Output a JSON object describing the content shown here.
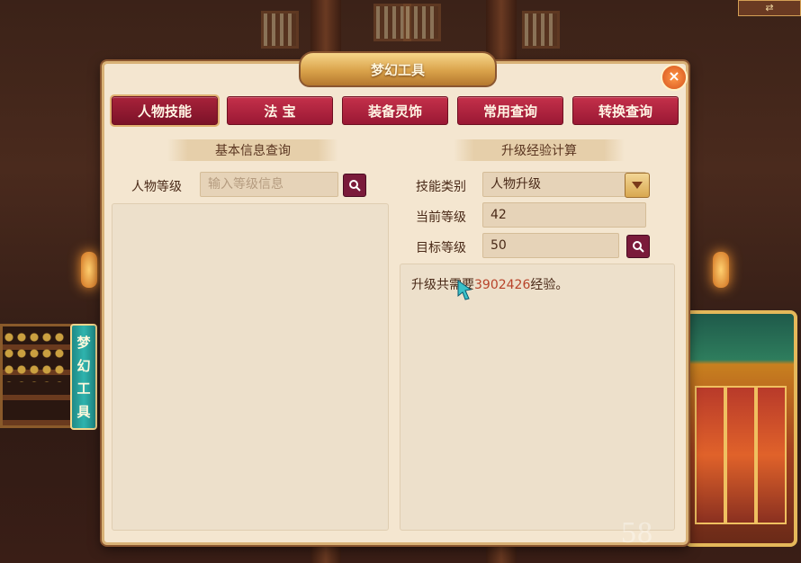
{
  "window": {
    "title": "梦幻工具",
    "close_label": "×"
  },
  "tabs": [
    {
      "label": "人物技能",
      "active": true
    },
    {
      "label": "法 宝",
      "active": false
    },
    {
      "label": "装备灵饰",
      "active": false
    },
    {
      "label": "常用查询",
      "active": false
    },
    {
      "label": "转换查询",
      "active": false
    }
  ],
  "left": {
    "header": "基本信息查询",
    "level_label": "人物等级",
    "level_placeholder": "输入等级信息"
  },
  "right": {
    "header": "升级经验计算",
    "skill_type_label": "技能类别",
    "skill_type_value": "人物升级",
    "current_level_label": "当前等级",
    "current_level_value": "42",
    "target_level_label": "目标等级",
    "target_level_value": "50",
    "result_prefix": "升级共需要",
    "result_value": "3902426",
    "result_suffix": "经验。"
  },
  "side_tab": {
    "chars": [
      "梦",
      "幻",
      "工",
      "具"
    ]
  },
  "watermark": "58",
  "colors": {
    "accent": "#9a1834",
    "result_number": "#b8432a"
  },
  "icons": [
    "search-icon",
    "dropdown-arrow-icon",
    "close-icon"
  ]
}
